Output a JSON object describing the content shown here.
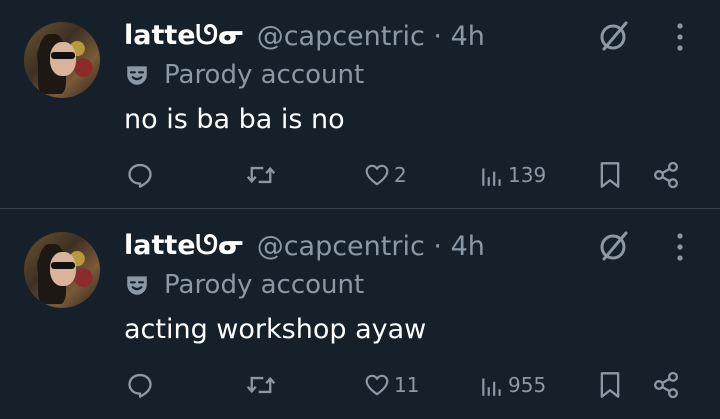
{
  "tweets": [
    {
      "display_name": "latteᘎᓂ",
      "handle_time": "@capcentric · 4h",
      "badge": "Parody account",
      "text": "no is ba ba is no",
      "likes": "2",
      "views": "139"
    },
    {
      "display_name": "latteᘎᓂ",
      "handle_time": "@capcentric · 4h",
      "badge": "Parody account",
      "text": "acting workshop ayaw",
      "likes": "11",
      "views": "955"
    }
  ],
  "colors": {
    "background": "#15202b",
    "text_primary": "#ffffff",
    "text_secondary": "#8b98a5",
    "divider": "#38444d"
  },
  "icons": [
    "mask-icon",
    "grok-icon",
    "more-icon",
    "reply-icon",
    "retweet-icon",
    "like-icon",
    "views-icon",
    "bookmark-icon",
    "share-icon"
  ]
}
